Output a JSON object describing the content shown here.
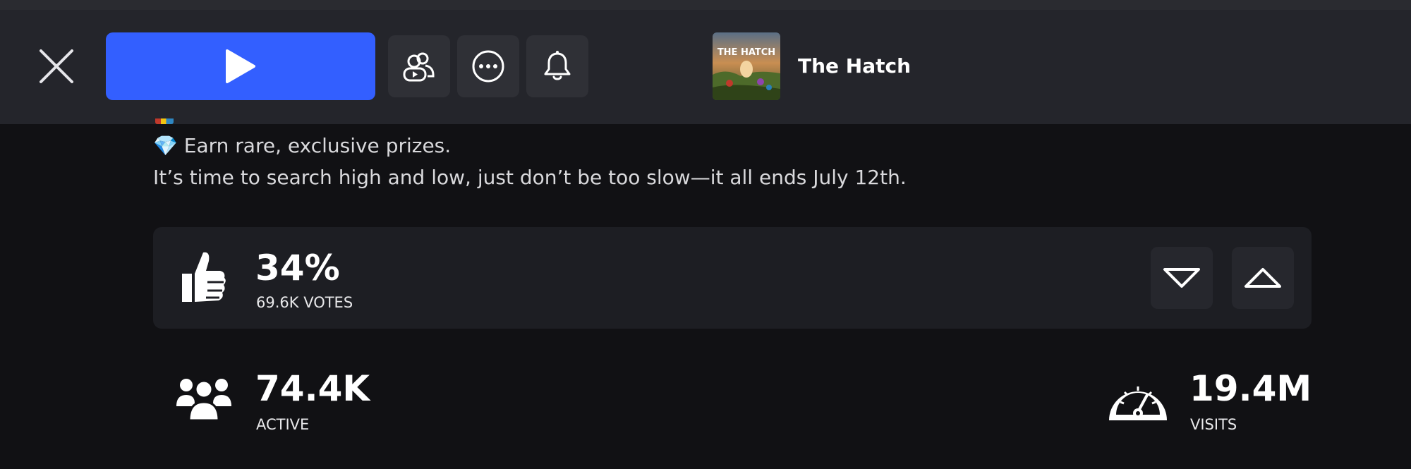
{
  "header": {
    "close_icon": "close-icon",
    "play_icon": "play-icon",
    "friends_icon": "friends-icon",
    "more_icon": "more-options-icon",
    "notify_icon": "bell-icon",
    "game": {
      "title": "The Hatch",
      "thumbnail_text": "THE HATCH"
    },
    "accent_color": "#335fff"
  },
  "description": {
    "line1_emoji": "💎",
    "line1": "Earn rare, exclusive prizes.",
    "line2": "It’s time to search high and low, just don’t be too slow—it all ends July 12th."
  },
  "votes": {
    "percent": "34%",
    "count_label": "69.6K VOTES",
    "like_fraction": 0.34,
    "icon": "thumbs-up-icon",
    "downvote_icon": "downvote-icon",
    "upvote_icon": "upvote-icon"
  },
  "stats": {
    "active": {
      "value": "74.4K",
      "label": "ACTIVE",
      "icon": "players-icon"
    },
    "visits": {
      "value": "19.4M",
      "label": "VISITS",
      "icon": "speedometer-icon"
    }
  }
}
